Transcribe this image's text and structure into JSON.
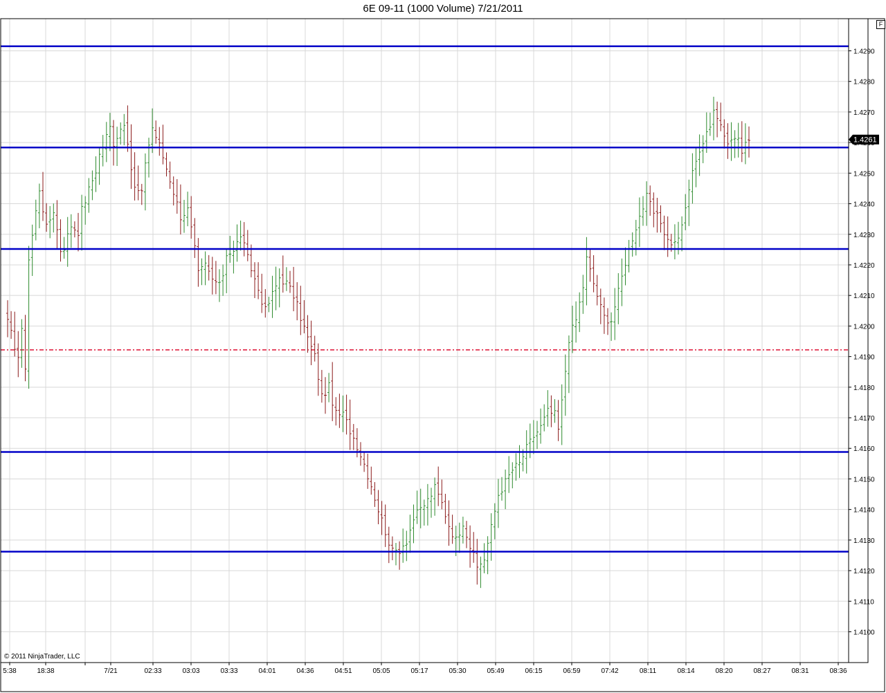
{
  "title": "6E 09-11 (1000 Volume)  7/21/2011",
  "float_button_label": "F",
  "copyright": "© 2011 NinjaTrader, LLC",
  "colors": {
    "up_bar": "#2e8b2e",
    "down_bar": "#8b1a1a",
    "level_line": "#0000c8",
    "reference_line": "#dd1133",
    "grid": "#d8d8d8",
    "last_price_tag": "#000000"
  },
  "chart_data": {
    "type": "bar",
    "instrument": "6E 09-11",
    "bar_period": "1000 Volume",
    "date": "7/21/2011",
    "ylim": [
      1.4092,
      1.4304
    ],
    "y_ticks": [
      "1.4100",
      "1.4110",
      "1.4120",
      "1.4130",
      "1.4140",
      "1.4150",
      "1.4160",
      "1.4170",
      "1.4180",
      "1.4190",
      "1.4200",
      "1.4210",
      "1.4220",
      "1.4230",
      "1.4240",
      "1.4250",
      "1.4260",
      "1.4270",
      "1.4280",
      "1.4290"
    ],
    "x_ticks": [
      "5:38",
      "18:38",
      "7/21",
      "02:33",
      "03:03",
      "03:33",
      "04:01",
      "04:36",
      "04:51",
      "05:05",
      "05:17",
      "05:30",
      "05:49",
      "06:15",
      "06:59",
      "07:42",
      "08:11",
      "08:14",
      "08:20",
      "08:27",
      "08:31",
      "08:36"
    ],
    "last_price": "1.4261",
    "horizontal_levels": [
      1.42915,
      1.42584,
      1.42252,
      1.41588,
      1.41262
    ],
    "reference_level": 1.41922,
    "price_path": [
      [
        0,
        1.4201
      ],
      [
        3,
        1.419
      ],
      [
        4,
        1.4198
      ],
      [
        5,
        1.4187
      ],
      [
        6,
        1.4222
      ],
      [
        9,
        1.4245
      ],
      [
        11,
        1.4232
      ],
      [
        13,
        1.4238
      ],
      [
        15,
        1.4225
      ],
      [
        16,
        1.4226
      ],
      [
        18,
        1.4233
      ],
      [
        20,
        1.4231
      ],
      [
        21,
        1.4238
      ],
      [
        25,
        1.4251
      ],
      [
        26,
        1.4256
      ],
      [
        29,
        1.4265
      ],
      [
        30,
        1.426
      ],
      [
        33,
        1.4267
      ],
      [
        34,
        1.4258
      ],
      [
        36,
        1.4245
      ],
      [
        38,
        1.4243
      ],
      [
        39,
        1.4254
      ],
      [
        41,
        1.4265
      ],
      [
        43,
        1.4259
      ],
      [
        46,
        1.4248
      ],
      [
        49,
        1.4236
      ],
      [
        51,
        1.4238
      ],
      [
        53,
        1.4225
      ],
      [
        54,
        1.4217
      ],
      [
        56,
        1.422
      ],
      [
        59,
        1.4213
      ],
      [
        61,
        1.4217
      ],
      [
        62,
        1.4224
      ],
      [
        64,
        1.4224
      ],
      [
        66,
        1.423
      ],
      [
        68,
        1.4222
      ],
      [
        71,
        1.4212
      ],
      [
        73,
        1.4205
      ],
      [
        76,
        1.4213
      ],
      [
        77,
        1.4216
      ],
      [
        79,
        1.4214
      ],
      [
        81,
        1.421
      ],
      [
        83,
        1.4203
      ],
      [
        85,
        1.4196
      ],
      [
        87,
        1.419
      ],
      [
        89,
        1.4177
      ],
      [
        91,
        1.418
      ],
      [
        93,
        1.4171
      ],
      [
        95,
        1.4171
      ],
      [
        97,
        1.4166
      ],
      [
        99,
        1.4161
      ],
      [
        101,
        1.4155
      ],
      [
        103,
        1.4148
      ],
      [
        105,
        1.414
      ],
      [
        107,
        1.4133
      ],
      [
        109,
        1.4126
      ],
      [
        111,
        1.4127
      ],
      [
        113,
        1.413
      ],
      [
        115,
        1.4137
      ],
      [
        117,
        1.414
      ],
      [
        119,
        1.4143
      ],
      [
        121,
        1.4147
      ],
      [
        123,
        1.4142
      ],
      [
        125,
        1.4135
      ],
      [
        127,
        1.413
      ],
      [
        129,
        1.4136
      ],
      [
        131,
        1.4128
      ],
      [
        133,
        1.4121
      ],
      [
        135,
        1.4124
      ],
      [
        137,
        1.4134
      ],
      [
        139,
        1.4145
      ],
      [
        141,
        1.4149
      ],
      [
        143,
        1.4153
      ],
      [
        145,
        1.4155
      ],
      [
        147,
        1.416
      ],
      [
        149,
        1.4164
      ],
      [
        151,
        1.4167
      ],
      [
        153,
        1.4172
      ],
      [
        155,
        1.4171
      ],
      [
        156,
        1.4166
      ],
      [
        157,
        1.4175
      ],
      [
        159,
        1.4196
      ],
      [
        161,
        1.4202
      ],
      [
        163,
        1.4213
      ],
      [
        164,
        1.4222
      ],
      [
        166,
        1.4214
      ],
      [
        168,
        1.4206
      ],
      [
        169,
        1.4203
      ],
      [
        171,
        1.4202
      ],
      [
        173,
        1.4211
      ],
      [
        175,
        1.4221
      ],
      [
        177,
        1.4229
      ],
      [
        179,
        1.4236
      ],
      [
        181,
        1.4242
      ],
      [
        183,
        1.4237
      ],
      [
        185,
        1.4234
      ],
      [
        187,
        1.4228
      ],
      [
        189,
        1.4227
      ],
      [
        191,
        1.4232
      ],
      [
        193,
        1.4245
      ],
      [
        195,
        1.4255
      ],
      [
        197,
        1.426
      ],
      [
        199,
        1.4265
      ],
      [
        200,
        1.4272
      ],
      [
        202,
        1.4266
      ],
      [
        204,
        1.426
      ],
      [
        206,
        1.4262
      ],
      [
        208,
        1.4258
      ],
      [
        210,
        1.4261
      ]
    ]
  }
}
